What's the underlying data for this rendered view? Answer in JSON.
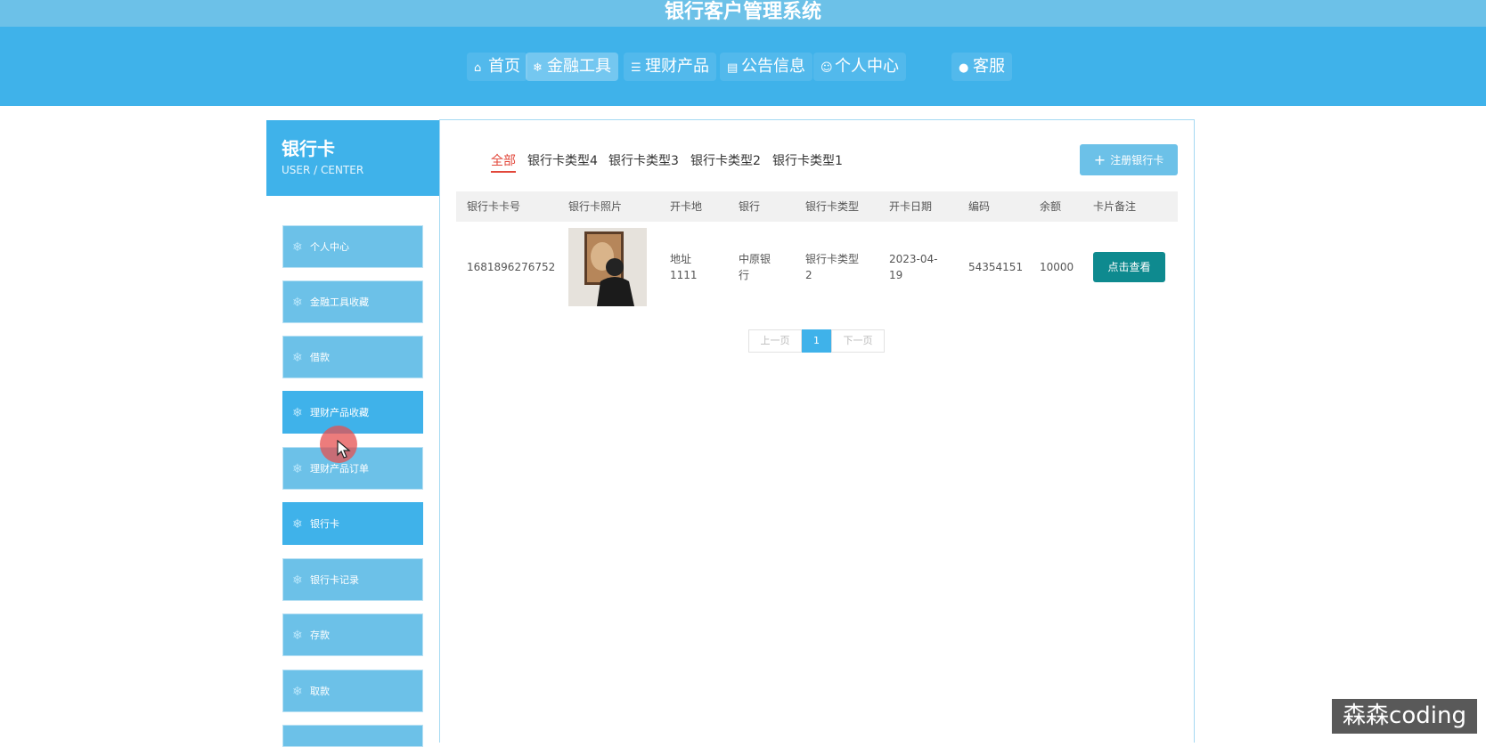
{
  "app": {
    "title": "银行客户管理系统"
  },
  "nav": {
    "items": [
      {
        "label": "首页",
        "icon": "home-icon"
      },
      {
        "label": "金融工具",
        "icon": "snowflake-icon",
        "active": true
      },
      {
        "label": "理财产品",
        "icon": "stack-icon"
      },
      {
        "label": "公告信息",
        "icon": "notice-icon"
      },
      {
        "label": "个人中心",
        "icon": "user-icon"
      },
      {
        "label": "客服",
        "icon": "chat-icon"
      }
    ]
  },
  "sidebar": {
    "title": "银行卡",
    "subtitle": "USER / CENTER",
    "items": [
      {
        "label": "个人中心"
      },
      {
        "label": "金融工具收藏"
      },
      {
        "label": "借款"
      },
      {
        "label": "理财产品收藏",
        "active": true
      },
      {
        "label": "理财产品订单"
      },
      {
        "label": "银行卡",
        "active": true
      },
      {
        "label": "银行卡记录"
      },
      {
        "label": "存款"
      },
      {
        "label": "取款"
      }
    ]
  },
  "filters": {
    "tabs": [
      "全部",
      "银行卡类型4",
      "银行卡类型3",
      "银行卡类型2",
      "银行卡类型1"
    ],
    "active": "全部"
  },
  "actions": {
    "add_label": "注册银行卡"
  },
  "table": {
    "headers": [
      "银行卡卡号",
      "银行卡照片",
      "开卡地",
      "银行",
      "银行卡类型",
      "开卡日期",
      "编码",
      "余额",
      "卡片备注"
    ],
    "rows": [
      {
        "card_no": "1681896276752",
        "location_l1": "地址",
        "location_l2": "1111",
        "bank_l1": "中原银",
        "bank_l2": "行",
        "type_l1": "银行卡类型",
        "type_l2": "2",
        "date_l1": "2023-04-",
        "date_l2": "19",
        "code": "54354151",
        "balance": "10000",
        "action_label": "点击查看"
      }
    ]
  },
  "pagination": {
    "prev": "上一页",
    "current": "1",
    "next": "下一页"
  },
  "watermark": "森森coding",
  "colors": {
    "header_blue": "#3fb2ea",
    "title_bar": "#6cc1e8",
    "sidebar_item": "#6cc1e8",
    "active_red": "#e2473a",
    "teal_button": "#0e8a8f"
  }
}
